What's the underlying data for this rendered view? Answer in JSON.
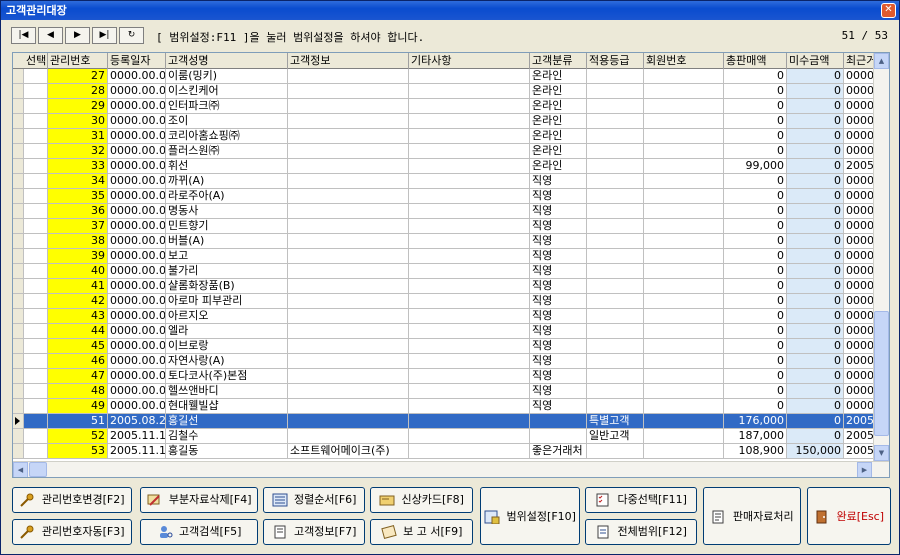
{
  "window": {
    "title": "고객관리대장",
    "close_glyph": "✕"
  },
  "toolbar": {
    "nav": [
      {
        "name": "first-record-button",
        "glyph": "|◀"
      },
      {
        "name": "prev-record-button",
        "glyph": "◀"
      },
      {
        "name": "next-record-button",
        "glyph": "▶"
      },
      {
        "name": "last-record-button",
        "glyph": "▶|"
      },
      {
        "name": "refresh-button",
        "glyph": "↻"
      }
    ],
    "range_hint": "[ 범위설정:F11 ]을 눌러 범위설정을 하셔야 합니다.",
    "page_count": "51 / 53"
  },
  "grid": {
    "columns": [
      "선택",
      "관리번호",
      "등록일자",
      "고객성명",
      "고객정보",
      "기타사항",
      "고객분류",
      "적용등급",
      "회원번호",
      "총판매액",
      "미수금액",
      "최근거"
    ],
    "rows": [
      {
        "no": "27",
        "date": "0000.00.00",
        "name": "이룸(밍키)",
        "info": "",
        "etc": "",
        "cat": "온라인",
        "grade": "",
        "member": "",
        "sales": "0",
        "unpaid": "0",
        "recent": "0000."
      },
      {
        "no": "28",
        "date": "0000.00.00",
        "name": "이스킨케어",
        "info": "",
        "etc": "",
        "cat": "온라인",
        "grade": "",
        "member": "",
        "sales": "0",
        "unpaid": "0",
        "recent": "0000."
      },
      {
        "no": "29",
        "date": "0000.00.00",
        "name": "인터파크㈜",
        "info": "",
        "etc": "",
        "cat": "온라인",
        "grade": "",
        "member": "",
        "sales": "0",
        "unpaid": "0",
        "recent": "0000."
      },
      {
        "no": "30",
        "date": "0000.00.00",
        "name": "조이",
        "info": "",
        "etc": "",
        "cat": "온라인",
        "grade": "",
        "member": "",
        "sales": "0",
        "unpaid": "0",
        "recent": "0000."
      },
      {
        "no": "31",
        "date": "0000.00.00",
        "name": "코리아홈쇼핑㈜",
        "info": "",
        "etc": "",
        "cat": "온라인",
        "grade": "",
        "member": "",
        "sales": "0",
        "unpaid": "0",
        "recent": "0000."
      },
      {
        "no": "32",
        "date": "0000.00.00",
        "name": "플러스원㈜",
        "info": "",
        "etc": "",
        "cat": "온라인",
        "grade": "",
        "member": "",
        "sales": "0",
        "unpaid": "0",
        "recent": "0000."
      },
      {
        "no": "33",
        "date": "0000.00.00",
        "name": "휘선",
        "info": "",
        "etc": "",
        "cat": "온라인",
        "grade": "",
        "member": "",
        "sales": "99,000",
        "unpaid": "0",
        "recent": "2005."
      },
      {
        "no": "34",
        "date": "0000.00.00",
        "name": "까뀌(A)",
        "info": "",
        "etc": "",
        "cat": "직영",
        "grade": "",
        "member": "",
        "sales": "0",
        "unpaid": "0",
        "recent": "0000."
      },
      {
        "no": "35",
        "date": "0000.00.00",
        "name": "라로주아(A)",
        "info": "",
        "etc": "",
        "cat": "직영",
        "grade": "",
        "member": "",
        "sales": "0",
        "unpaid": "0",
        "recent": "0000."
      },
      {
        "no": "36",
        "date": "0000.00.00",
        "name": "명동사",
        "info": "",
        "etc": "",
        "cat": "직영",
        "grade": "",
        "member": "",
        "sales": "0",
        "unpaid": "0",
        "recent": "0000."
      },
      {
        "no": "37",
        "date": "0000.00.00",
        "name": "민트향기",
        "info": "",
        "etc": "",
        "cat": "직영",
        "grade": "",
        "member": "",
        "sales": "0",
        "unpaid": "0",
        "recent": "0000."
      },
      {
        "no": "38",
        "date": "0000.00.00",
        "name": "버블(A)",
        "info": "",
        "etc": "",
        "cat": "직영",
        "grade": "",
        "member": "",
        "sales": "0",
        "unpaid": "0",
        "recent": "0000."
      },
      {
        "no": "39",
        "date": "0000.00.00",
        "name": "보고",
        "info": "",
        "etc": "",
        "cat": "직영",
        "grade": "",
        "member": "",
        "sales": "0",
        "unpaid": "0",
        "recent": "0000."
      },
      {
        "no": "40",
        "date": "0000.00.00",
        "name": "불가리",
        "info": "",
        "etc": "",
        "cat": "직영",
        "grade": "",
        "member": "",
        "sales": "0",
        "unpaid": "0",
        "recent": "0000."
      },
      {
        "no": "41",
        "date": "0000.00.00",
        "name": "샬롬화장품(B)",
        "info": "",
        "etc": "",
        "cat": "직영",
        "grade": "",
        "member": "",
        "sales": "0",
        "unpaid": "0",
        "recent": "0000."
      },
      {
        "no": "42",
        "date": "0000.00.00",
        "name": "아로마 피부관리",
        "info": "",
        "etc": "",
        "cat": "직영",
        "grade": "",
        "member": "",
        "sales": "0",
        "unpaid": "0",
        "recent": "0000."
      },
      {
        "no": "43",
        "date": "0000.00.00",
        "name": "아르지오",
        "info": "",
        "etc": "",
        "cat": "직영",
        "grade": "",
        "member": "",
        "sales": "0",
        "unpaid": "0",
        "recent": "0000."
      },
      {
        "no": "44",
        "date": "0000.00.00",
        "name": "엘라",
        "info": "",
        "etc": "",
        "cat": "직영",
        "grade": "",
        "member": "",
        "sales": "0",
        "unpaid": "0",
        "recent": "0000."
      },
      {
        "no": "45",
        "date": "0000.00.00",
        "name": "이브로랑",
        "info": "",
        "etc": "",
        "cat": "직영",
        "grade": "",
        "member": "",
        "sales": "0",
        "unpaid": "0",
        "recent": "0000."
      },
      {
        "no": "46",
        "date": "0000.00.00",
        "name": "자연사랑(A)",
        "info": "",
        "etc": "",
        "cat": "직영",
        "grade": "",
        "member": "",
        "sales": "0",
        "unpaid": "0",
        "recent": "0000."
      },
      {
        "no": "47",
        "date": "0000.00.00",
        "name": "토다코사(주)본점",
        "info": "",
        "etc": "",
        "cat": "직영",
        "grade": "",
        "member": "",
        "sales": "0",
        "unpaid": "0",
        "recent": "0000."
      },
      {
        "no": "48",
        "date": "0000.00.00",
        "name": "헬쓰앤바디",
        "info": "",
        "etc": "",
        "cat": "직영",
        "grade": "",
        "member": "",
        "sales": "0",
        "unpaid": "0",
        "recent": "0000."
      },
      {
        "no": "49",
        "date": "0000.00.00",
        "name": "현대웰빌샵",
        "info": "",
        "etc": "",
        "cat": "직영",
        "grade": "",
        "member": "",
        "sales": "0",
        "unpaid": "0",
        "recent": "0000."
      },
      {
        "no": "51",
        "date": "2005.08.22",
        "name": "홍길선",
        "info": "",
        "etc": "",
        "cat": "",
        "grade": "특별고객",
        "member": "",
        "sales": "176,000",
        "unpaid": "0",
        "recent": "2005.",
        "selected": true
      },
      {
        "no": "52",
        "date": "2005.11.15",
        "name": "김철수",
        "info": "",
        "etc": "",
        "cat": "",
        "grade": "일반고객",
        "member": "",
        "sales": "187,000",
        "unpaid": "0",
        "recent": "2005."
      },
      {
        "no": "53",
        "date": "2005.11.16",
        "name": "홍길동",
        "info": "소프트웨어메이크(주)",
        "etc": "",
        "cat": "좋은거래처",
        "grade": "",
        "member": "",
        "sales": "108,900",
        "unpaid": "150,000",
        "recent": "2005."
      }
    ]
  },
  "buttons": {
    "change_no": "관리번호변경[F2]",
    "auto_no": "관리번호자동[F3]",
    "partial_delete": "부분자료삭제[F4]",
    "customer_search": "고객검색[F5]",
    "sort_order": "정렬순서[F6]",
    "customer_info": "고객정보[F7]",
    "credit_card": "신상카드[F8]",
    "report": "보 고 서[F9]",
    "range_setting": "범위설정[F10]",
    "multi_select": "다중선택[F11]",
    "full_range": "전체범위[F12]",
    "sales_process": "판매자료처리",
    "done": "완료[Esc]"
  }
}
